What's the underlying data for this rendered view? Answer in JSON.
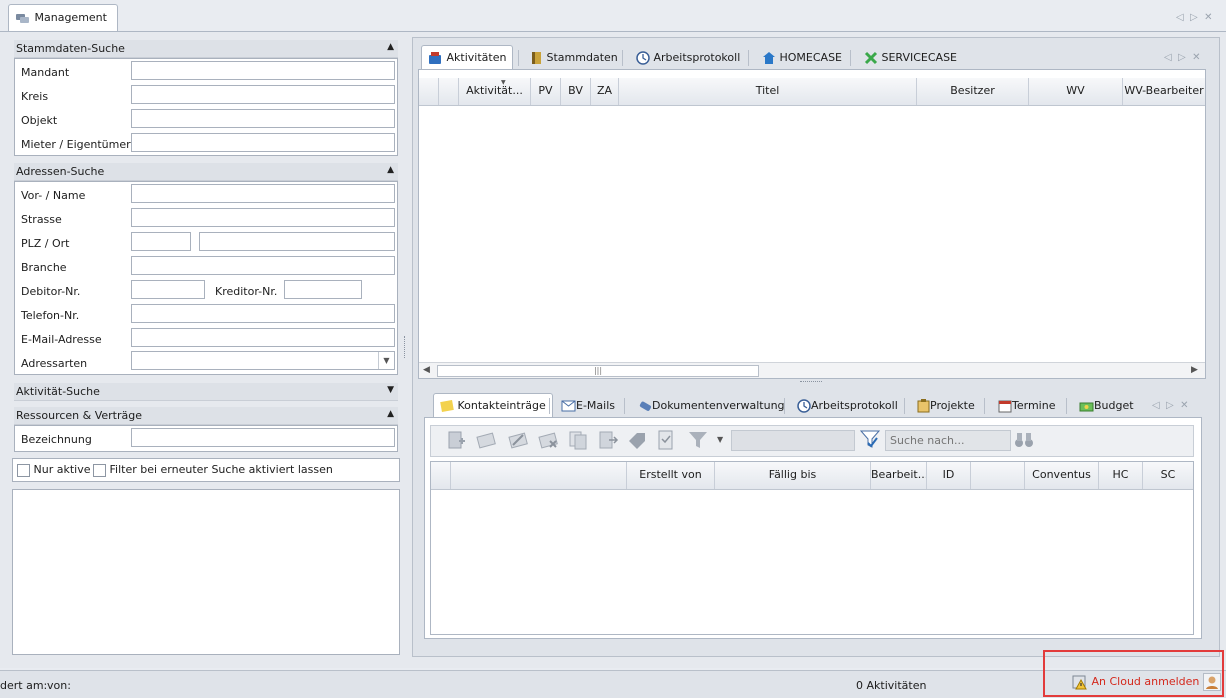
{
  "main_tab": {
    "label": "Management"
  },
  "left": {
    "stammdaten": {
      "title": "Stammdaten-Suche",
      "fields": [
        "Mandant",
        "Kreis",
        "Objekt",
        "Mieter / Eigentümer"
      ]
    },
    "adressen": {
      "title": "Adressen-Suche",
      "vorname": "Vor- / Name",
      "strasse": "Strasse",
      "plz": "PLZ / Ort",
      "branche": "Branche",
      "debitor": "Debitor-Nr.",
      "kreditor": "Kreditor-Nr.",
      "telefon": "Telefon-Nr.",
      "email": "E-Mail-Adresse",
      "adressarten": "Adressarten"
    },
    "aktivitaet": {
      "title": "Aktivität-Suche"
    },
    "ressourcen": {
      "title": "Ressourcen & Verträge",
      "bezeichnung": "Bezeichnung"
    },
    "nur_aktive": "Nur aktive",
    "filter_label": "Filter bei erneuter Suche aktiviert lassen"
  },
  "top_tabs": [
    "Aktivitäten",
    "Stammdaten",
    "Arbeitsprotokoll",
    "HOMECASE",
    "SERVICECASE"
  ],
  "top_grid": {
    "columns": [
      "Aktivität...",
      "PV",
      "BV",
      "ZA",
      "Titel",
      "Besitzer",
      "WV",
      "WV-Bearbeiter"
    ]
  },
  "bottom_tabs": [
    "Kontakteinträge",
    "E-Mails",
    "Dokumentenverwaltung",
    "Arbeitsprotokoll",
    "Projekte",
    "Termine",
    "Budget"
  ],
  "toolbar": {
    "search_placeholder": "Suche nach..."
  },
  "bottom_grid": {
    "columns": [
      "Erstellt von",
      "Fällig bis",
      "Bearbeit...",
      "ID",
      "Conventus",
      "HC",
      "SC"
    ]
  },
  "status": {
    "left": "dert am:",
    "von": "von:",
    "count": "0 Aktivitäten",
    "cloud": "An Cloud anmelden"
  },
  "colors": {
    "highlight_box": "#e23b3b",
    "cloud_text": "#d4281c"
  }
}
